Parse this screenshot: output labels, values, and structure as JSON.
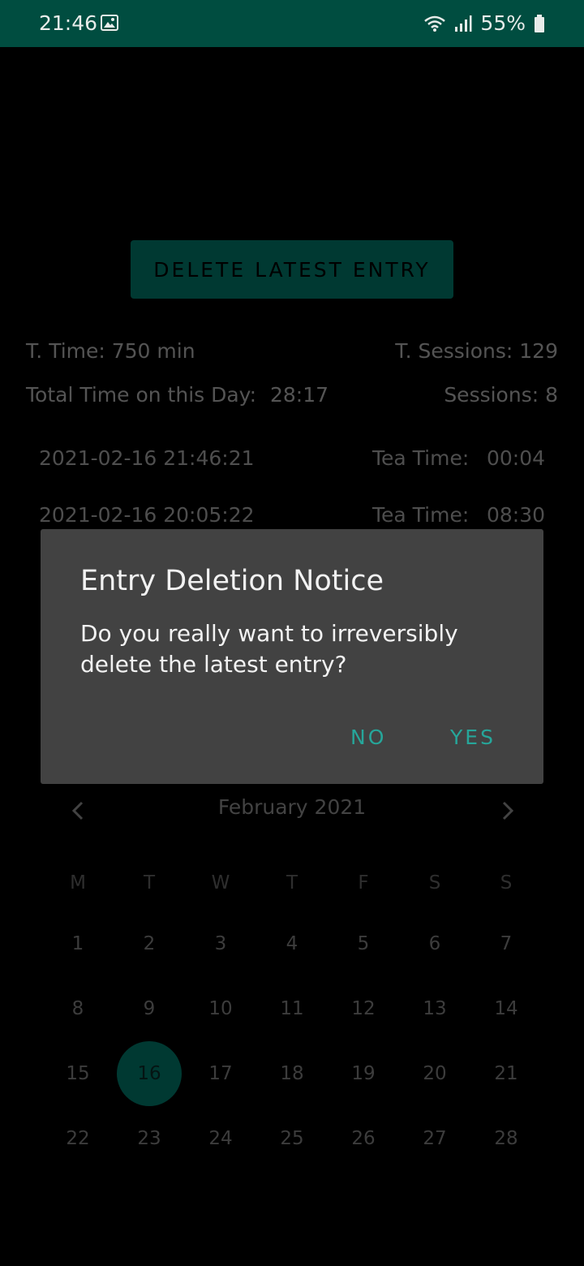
{
  "status_bar": {
    "time": "21:46",
    "battery": "55%",
    "icons": [
      "image-icon",
      "wifi-icon",
      "signal-icon",
      "battery-icon"
    ]
  },
  "delete_button": {
    "label": "DELETE LATEST ENTRY"
  },
  "stats": {
    "total_time": "T. Time: 750 min",
    "total_sessions": "T. Sessions: 129",
    "day_total_label": "Total Time on this Day:",
    "day_total_value": "28:17",
    "day_sessions": "Sessions: 8"
  },
  "entries": [
    {
      "timestamp": "2021-02-16 21:46:21",
      "label": "Tea Time:",
      "value": "00:04"
    },
    {
      "timestamp": "2021-02-16 20:05:22",
      "label": "Tea Time:",
      "value": "08:30"
    }
  ],
  "dialog": {
    "title": "Entry Deletion Notice",
    "message": "Do you really want to irreversibly delete the latest entry?",
    "no_label": "NO",
    "yes_label": "YES"
  },
  "calendar": {
    "month": "February 2021",
    "weekdays": [
      "M",
      "T",
      "W",
      "T",
      "F",
      "S",
      "S"
    ],
    "weeks": [
      [
        "1",
        "2",
        "3",
        "4",
        "5",
        "6",
        "7"
      ],
      [
        "8",
        "9",
        "10",
        "11",
        "12",
        "13",
        "14"
      ],
      [
        "15",
        "16",
        "17",
        "18",
        "19",
        "20",
        "21"
      ],
      [
        "22",
        "23",
        "24",
        "25",
        "26",
        "27",
        "28"
      ]
    ],
    "selected_day": "16"
  },
  "colors": {
    "status_bar": "#004d40",
    "accent": "#00695c",
    "dialog_button": "#26a69a",
    "dialog_bg": "#424242"
  }
}
